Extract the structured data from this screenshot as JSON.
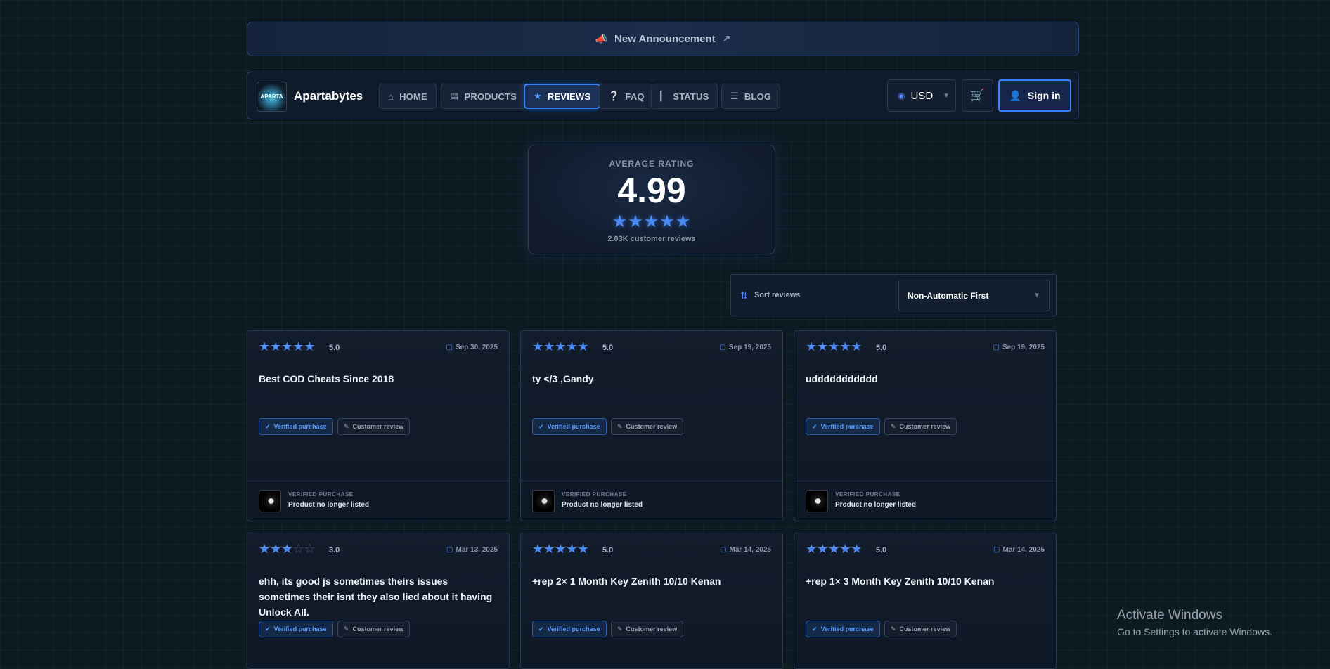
{
  "announcement": {
    "text": "New Announcement",
    "icon": "megaphone-icon",
    "link_icon": "external-link-icon"
  },
  "nav": {
    "brand": "Apartabytes",
    "logo_text": "APARTA",
    "items": [
      {
        "label": "HOME",
        "icon": "home-icon"
      },
      {
        "label": "PRODUCTS",
        "icon": "boxes-icon"
      },
      {
        "label": "REVIEWS",
        "icon": "star-icon",
        "active": true
      },
      {
        "label": "FAQ",
        "icon": "question-icon"
      },
      {
        "label": "STATUS",
        "icon": "signal-icon"
      },
      {
        "label": "BLOG",
        "icon": "newspaper-icon"
      }
    ],
    "currency": "USD",
    "signin": "Sign in"
  },
  "rating": {
    "label": "AVERAGE RATING",
    "value": "4.99",
    "stars": 5,
    "count": "2.03K customer reviews"
  },
  "sort": {
    "label": "Sort reviews",
    "value": "Non-Automatic First"
  },
  "reviews": [
    {
      "stars": 5,
      "score": "5.0",
      "date": "Sep 30, 2025",
      "title": "Best COD Cheats Since 2018",
      "verified": "Verified purchase",
      "type": "Customer review",
      "product_label": "VERIFIED PURCHASE",
      "product": "Product no longer listed"
    },
    {
      "stars": 5,
      "score": "5.0",
      "date": "Sep 19, 2025",
      "title": "ty </3 ,Gandy",
      "verified": "Verified purchase",
      "type": "Customer review",
      "product_label": "VERIFIED PURCHASE",
      "product": "Product no longer listed"
    },
    {
      "stars": 5,
      "score": "5.0",
      "date": "Sep 19, 2025",
      "title": "uddddddddddd",
      "verified": "Verified purchase",
      "type": "Customer review",
      "product_label": "VERIFIED PURCHASE",
      "product": "Product no longer listed"
    },
    {
      "stars": 3,
      "score": "3.0",
      "date": "Mar 13, 2025",
      "title": "ehh, its good js sometimes theirs issues sometimes their isnt they also lied about it having Unlock All.",
      "verified": "Verified purchase",
      "type": "Customer review"
    },
    {
      "stars": 5,
      "score": "5.0",
      "date": "Mar 14, 2025",
      "title": "+rep 2× 1 Month Key Zenith 10/10 Kenan",
      "verified": "Verified purchase",
      "type": "Customer review"
    },
    {
      "stars": 5,
      "score": "5.0",
      "date": "Mar 14, 2025",
      "title": "+rep 1× 3 Month Key Zenith 10/10 Kenan",
      "verified": "Verified purchase",
      "type": "Customer review"
    }
  ],
  "watermark": {
    "line1": "Activate Windows",
    "line2": "Go to Settings to activate Windows."
  },
  "colors": {
    "accent": "#3b82f6",
    "background": "#0d1a22",
    "star": "#4a8bf5"
  }
}
